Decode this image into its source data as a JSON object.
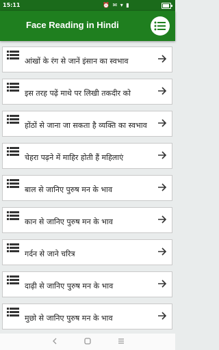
{
  "status_bar": {
    "time": "15:11",
    "icons": "⏰ ✉ ▾ ▮"
  },
  "app_bar": {
    "title": "Face Reading in Hindi",
    "menu_icon": "list-menu-icon"
  },
  "list": {
    "items": [
      {
        "label": "आंखों के रंग से जानें इंसान का स्वभाव"
      },
      {
        "label": "इस तरह पढ़ें माथे पर लिखी तकदीर को"
      },
      {
        "label": "होंठों से जाना जा सकता है व्यक्ति का स्वभाव"
      },
      {
        "label": "चेहरा पढ़ने में माहिर होती हैं महिलाएं"
      },
      {
        "label": "बाल से जानिए पुरुष मन के भाव"
      },
      {
        "label": "कान से जानिए पुरुष मन के भाव"
      },
      {
        "label": "गर्दन से जाने चरित्र"
      },
      {
        "label": "दाढ़ी से जानिए पुरुष मन के भाव"
      },
      {
        "label": "मुछो से जानिए पुरुष मन के भाव"
      }
    ]
  },
  "colors": {
    "status_bar": "#1b6b1b",
    "app_bar": "#1f7f1f",
    "background": "#e9ecec"
  },
  "nav_bar": {
    "back": "back-icon",
    "home": "home-icon",
    "recents": "recents-icon"
  }
}
